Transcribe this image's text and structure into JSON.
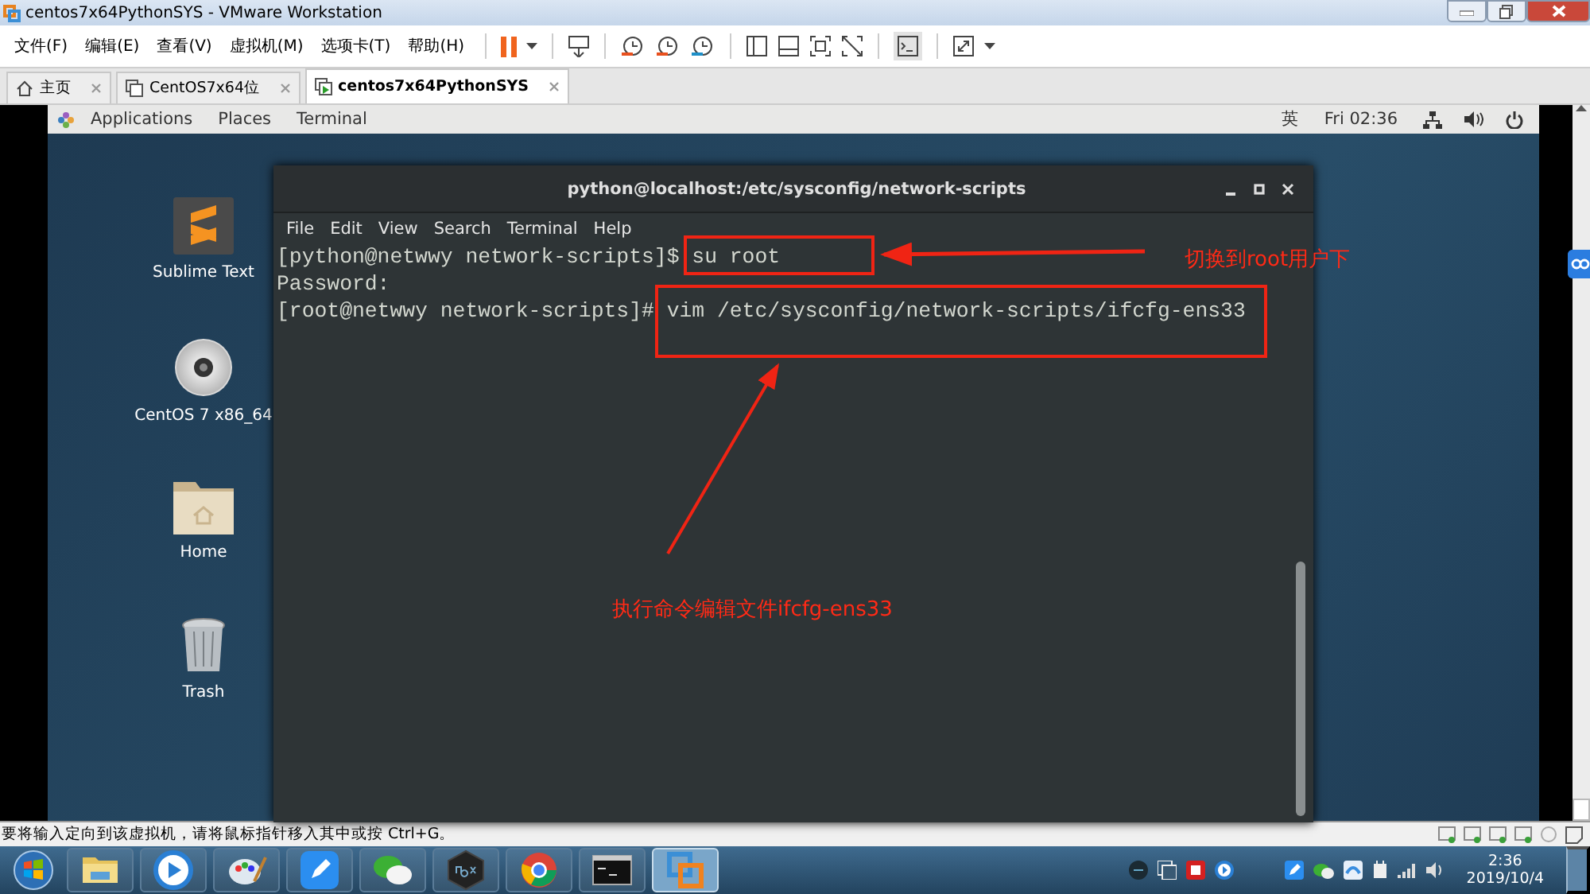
{
  "window": {
    "title": "centos7x64PythonSYS - VMware Workstation"
  },
  "menu": [
    "文件(F)",
    "编辑(E)",
    "查看(V)",
    "虚拟机(M)",
    "选项卡(T)",
    "帮助(H)"
  ],
  "tabs": [
    {
      "label": "主页",
      "selected": false,
      "kind": "home"
    },
    {
      "label": "CentOS7x64位",
      "selected": false,
      "kind": "vm"
    },
    {
      "label": "centos7x64PythonSYS",
      "selected": true,
      "kind": "vm-running"
    }
  ],
  "gnome_bar": {
    "menus": [
      "Applications",
      "Places",
      "Terminal"
    ],
    "input_method": "英",
    "clock": "Fri 02:36"
  },
  "desktop_icons": [
    {
      "label": "Sublime Text",
      "kind": "sublime"
    },
    {
      "label": "CentOS 7 x86_64",
      "kind": "disc"
    },
    {
      "label": "Home",
      "kind": "folder"
    },
    {
      "label": "Trash",
      "kind": "trash"
    }
  ],
  "terminal": {
    "title": "python@localhost:/etc/sysconfig/network-scripts",
    "menu": [
      "File",
      "Edit",
      "View",
      "Search",
      "Terminal",
      "Help"
    ],
    "lines": [
      "[python@netwwy network-scripts]$ su root",
      "Password:",
      "[root@netwwy network-scripts]# vim /etc/sysconfig/network-scripts/ifcfg-ens33"
    ]
  },
  "annotations": [
    {
      "text": "切换到root用户下"
    },
    {
      "text": "执行命令编辑文件ifcfg-ens33"
    }
  ],
  "status_bar": {
    "message": "要将输入定向到该虚拟机，请将鼠标指针移入其中或按 Ctrl+G。"
  },
  "taskbar": {
    "apps": [
      {
        "kind": "explorer",
        "selected": false
      },
      {
        "kind": "player",
        "selected": false
      },
      {
        "kind": "paint",
        "selected": false
      },
      {
        "kind": "pen",
        "selected": false
      },
      {
        "kind": "chat",
        "selected": false
      },
      {
        "kind": "hexagon",
        "selected": false
      },
      {
        "kind": "browser",
        "selected": false
      },
      {
        "kind": "console",
        "selected": false
      },
      {
        "kind": "vmware",
        "selected": true
      }
    ],
    "clock": {
      "time": "2:36",
      "date": "2019/10/4"
    }
  }
}
